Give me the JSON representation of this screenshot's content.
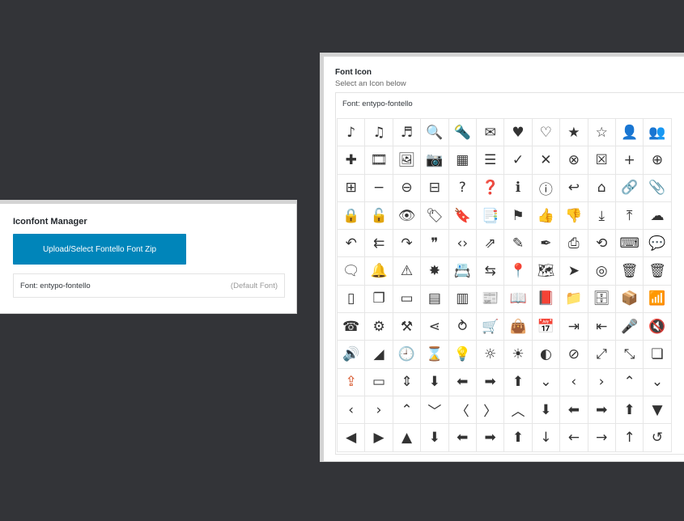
{
  "iconfont_manager": {
    "title": "Iconfont Manager",
    "upload_label": "Upload/Select Fontello Font Zip",
    "font_label": "Font: entypo-fontello",
    "font_default": "(Default Font)"
  },
  "font_icon": {
    "title": "Font Icon",
    "subtitle": "Select an Icon below",
    "font_label": "Font: entypo-fontello",
    "icons": [
      {
        "name": "note",
        "glyph": "♪"
      },
      {
        "name": "note-beamed",
        "glyph": "♫"
      },
      {
        "name": "music",
        "glyph": "♬"
      },
      {
        "name": "search",
        "glyph": "🔍"
      },
      {
        "name": "flashlight",
        "glyph": "🔦"
      },
      {
        "name": "mail",
        "glyph": "✉"
      },
      {
        "name": "heart",
        "glyph": "♥"
      },
      {
        "name": "heart-empty",
        "glyph": "♡"
      },
      {
        "name": "star",
        "glyph": "★"
      },
      {
        "name": "star-empty",
        "glyph": "☆"
      },
      {
        "name": "user",
        "glyph": "👤"
      },
      {
        "name": "users",
        "glyph": "👥"
      },
      {
        "name": "user-add",
        "glyph": "✚"
      },
      {
        "name": "video",
        "glyph": "🎞"
      },
      {
        "name": "picture",
        "glyph": "🖼"
      },
      {
        "name": "camera",
        "glyph": "📷"
      },
      {
        "name": "layout",
        "glyph": "▦"
      },
      {
        "name": "menu",
        "glyph": "☰"
      },
      {
        "name": "check",
        "glyph": "✓"
      },
      {
        "name": "cancel",
        "glyph": "✕"
      },
      {
        "name": "cancel-circled",
        "glyph": "⊗"
      },
      {
        "name": "cancel-squared",
        "glyph": "☒"
      },
      {
        "name": "plus",
        "glyph": "+"
      },
      {
        "name": "plus-circled",
        "glyph": "⊕"
      },
      {
        "name": "plus-squared",
        "glyph": "⊞"
      },
      {
        "name": "minus",
        "glyph": "−"
      },
      {
        "name": "minus-circled",
        "glyph": "⊖"
      },
      {
        "name": "minus-squared",
        "glyph": "⊟"
      },
      {
        "name": "help",
        "glyph": "?"
      },
      {
        "name": "help-circled",
        "glyph": "❓"
      },
      {
        "name": "info",
        "glyph": "ℹ"
      },
      {
        "name": "info-circled",
        "glyph": "ⓘ"
      },
      {
        "name": "back",
        "glyph": "↩"
      },
      {
        "name": "home",
        "glyph": "⌂"
      },
      {
        "name": "link",
        "glyph": "🔗"
      },
      {
        "name": "attach",
        "glyph": "📎"
      },
      {
        "name": "lock",
        "glyph": "🔒"
      },
      {
        "name": "lock-open",
        "glyph": "🔓"
      },
      {
        "name": "eye",
        "glyph": "👁"
      },
      {
        "name": "tag",
        "glyph": "🏷"
      },
      {
        "name": "bookmark",
        "glyph": "🔖"
      },
      {
        "name": "bookmarks",
        "glyph": "📑"
      },
      {
        "name": "flag",
        "glyph": "⚑"
      },
      {
        "name": "thumbs-up",
        "glyph": "👍"
      },
      {
        "name": "thumbs-down",
        "glyph": "👎"
      },
      {
        "name": "download",
        "glyph": "⤓"
      },
      {
        "name": "upload",
        "glyph": "⤒"
      },
      {
        "name": "upload-cloud",
        "glyph": "☁"
      },
      {
        "name": "reply",
        "glyph": "↶"
      },
      {
        "name": "reply-all",
        "glyph": "⇇"
      },
      {
        "name": "forward",
        "glyph": "↷"
      },
      {
        "name": "quote",
        "glyph": "❞"
      },
      {
        "name": "code",
        "glyph": "‹›"
      },
      {
        "name": "export",
        "glyph": "⇗"
      },
      {
        "name": "pencil",
        "glyph": "✎"
      },
      {
        "name": "feather",
        "glyph": "✒"
      },
      {
        "name": "print",
        "glyph": "⎙"
      },
      {
        "name": "retweet",
        "glyph": "⟲"
      },
      {
        "name": "keyboard",
        "glyph": "⌨"
      },
      {
        "name": "comment",
        "glyph": "💬"
      },
      {
        "name": "chat",
        "glyph": "🗨"
      },
      {
        "name": "bell",
        "glyph": "🔔"
      },
      {
        "name": "attention",
        "glyph": "⚠"
      },
      {
        "name": "alert",
        "glyph": "✸"
      },
      {
        "name": "vcard",
        "glyph": "📇"
      },
      {
        "name": "direction",
        "glyph": "⇆"
      },
      {
        "name": "location",
        "glyph": "📍"
      },
      {
        "name": "map",
        "glyph": "🗺"
      },
      {
        "name": "compass",
        "glyph": "➤"
      },
      {
        "name": "compass-circled",
        "glyph": "◎"
      },
      {
        "name": "trash",
        "glyph": "🗑"
      },
      {
        "name": "trash-full",
        "glyph": "🗑"
      },
      {
        "name": "doc",
        "glyph": "▯"
      },
      {
        "name": "docs",
        "glyph": "❐"
      },
      {
        "name": "doc-landscape",
        "glyph": "▭"
      },
      {
        "name": "doc-text",
        "glyph": "▤"
      },
      {
        "name": "doc-text-inv",
        "glyph": "▥"
      },
      {
        "name": "newspaper",
        "glyph": "📰"
      },
      {
        "name": "book-open",
        "glyph": "📖"
      },
      {
        "name": "book",
        "glyph": "📕"
      },
      {
        "name": "folder",
        "glyph": "📁"
      },
      {
        "name": "archive",
        "glyph": "🗄"
      },
      {
        "name": "box",
        "glyph": "📦"
      },
      {
        "name": "rss",
        "glyph": "📶"
      },
      {
        "name": "phone",
        "glyph": "☎"
      },
      {
        "name": "cog",
        "glyph": "⚙"
      },
      {
        "name": "tools",
        "glyph": "⚒"
      },
      {
        "name": "share",
        "glyph": "⋖"
      },
      {
        "name": "shareable",
        "glyph": "⥁"
      },
      {
        "name": "basket",
        "glyph": "🛒"
      },
      {
        "name": "bag",
        "glyph": "👜"
      },
      {
        "name": "calendar",
        "glyph": "📅"
      },
      {
        "name": "login",
        "glyph": "⇥"
      },
      {
        "name": "logout",
        "glyph": "⇤"
      },
      {
        "name": "mic",
        "glyph": "🎤"
      },
      {
        "name": "mute",
        "glyph": "🔇"
      },
      {
        "name": "sound",
        "glyph": "🔊"
      },
      {
        "name": "volume",
        "glyph": "◢"
      },
      {
        "name": "clock",
        "glyph": "🕘"
      },
      {
        "name": "hourglass",
        "glyph": "⌛"
      },
      {
        "name": "lamp",
        "glyph": "💡"
      },
      {
        "name": "light-down",
        "glyph": "☼"
      },
      {
        "name": "light-up",
        "glyph": "☀"
      },
      {
        "name": "adjust",
        "glyph": "◐"
      },
      {
        "name": "block",
        "glyph": "⊘"
      },
      {
        "name": "resize-full",
        "glyph": "⤢"
      },
      {
        "name": "resize-small",
        "glyph": "⤡"
      },
      {
        "name": "popup",
        "glyph": "❏"
      },
      {
        "name": "publish",
        "glyph": "⇪"
      },
      {
        "name": "window",
        "glyph": "▭"
      },
      {
        "name": "arrow-combo",
        "glyph": "⇕"
      },
      {
        "name": "down-circled",
        "glyph": "⬇"
      },
      {
        "name": "left-circled",
        "glyph": "⬅"
      },
      {
        "name": "right-circled",
        "glyph": "➡"
      },
      {
        "name": "up-circled",
        "glyph": "⬆"
      },
      {
        "name": "down-open",
        "glyph": "⌄"
      },
      {
        "name": "left-open",
        "glyph": "‹"
      },
      {
        "name": "right-open",
        "glyph": "›"
      },
      {
        "name": "up-open",
        "glyph": "⌃"
      },
      {
        "name": "down-open-mini",
        "glyph": "⌄"
      },
      {
        "name": "left-open-mini",
        "glyph": "‹"
      },
      {
        "name": "right-open-mini",
        "glyph": "›"
      },
      {
        "name": "up-open-mini",
        "glyph": "⌃"
      },
      {
        "name": "down-open-big",
        "glyph": "﹀"
      },
      {
        "name": "left-open-big",
        "glyph": "〈"
      },
      {
        "name": "right-open-big",
        "glyph": "〉"
      },
      {
        "name": "up-open-big",
        "glyph": "︿"
      },
      {
        "name": "down",
        "glyph": "⬇"
      },
      {
        "name": "left",
        "glyph": "⬅"
      },
      {
        "name": "right",
        "glyph": "➡"
      },
      {
        "name": "up",
        "glyph": "⬆"
      },
      {
        "name": "down-dir",
        "glyph": "▼"
      },
      {
        "name": "left-dir",
        "glyph": "◀"
      },
      {
        "name": "right-dir",
        "glyph": "▶"
      },
      {
        "name": "up-dir",
        "glyph": "▲"
      },
      {
        "name": "down-bold",
        "glyph": "⬇"
      },
      {
        "name": "left-bold",
        "glyph": "⬅"
      },
      {
        "name": "right-bold",
        "glyph": "➡"
      },
      {
        "name": "up-bold",
        "glyph": "⬆"
      },
      {
        "name": "down-thin",
        "glyph": "↓"
      },
      {
        "name": "left-thin",
        "glyph": "←"
      },
      {
        "name": "right-thin",
        "glyph": "→"
      },
      {
        "name": "up-thin",
        "glyph": "↑"
      },
      {
        "name": "ccw",
        "glyph": "↺"
      }
    ],
    "selected_index": 108,
    "selected_color": "#d54e21"
  }
}
